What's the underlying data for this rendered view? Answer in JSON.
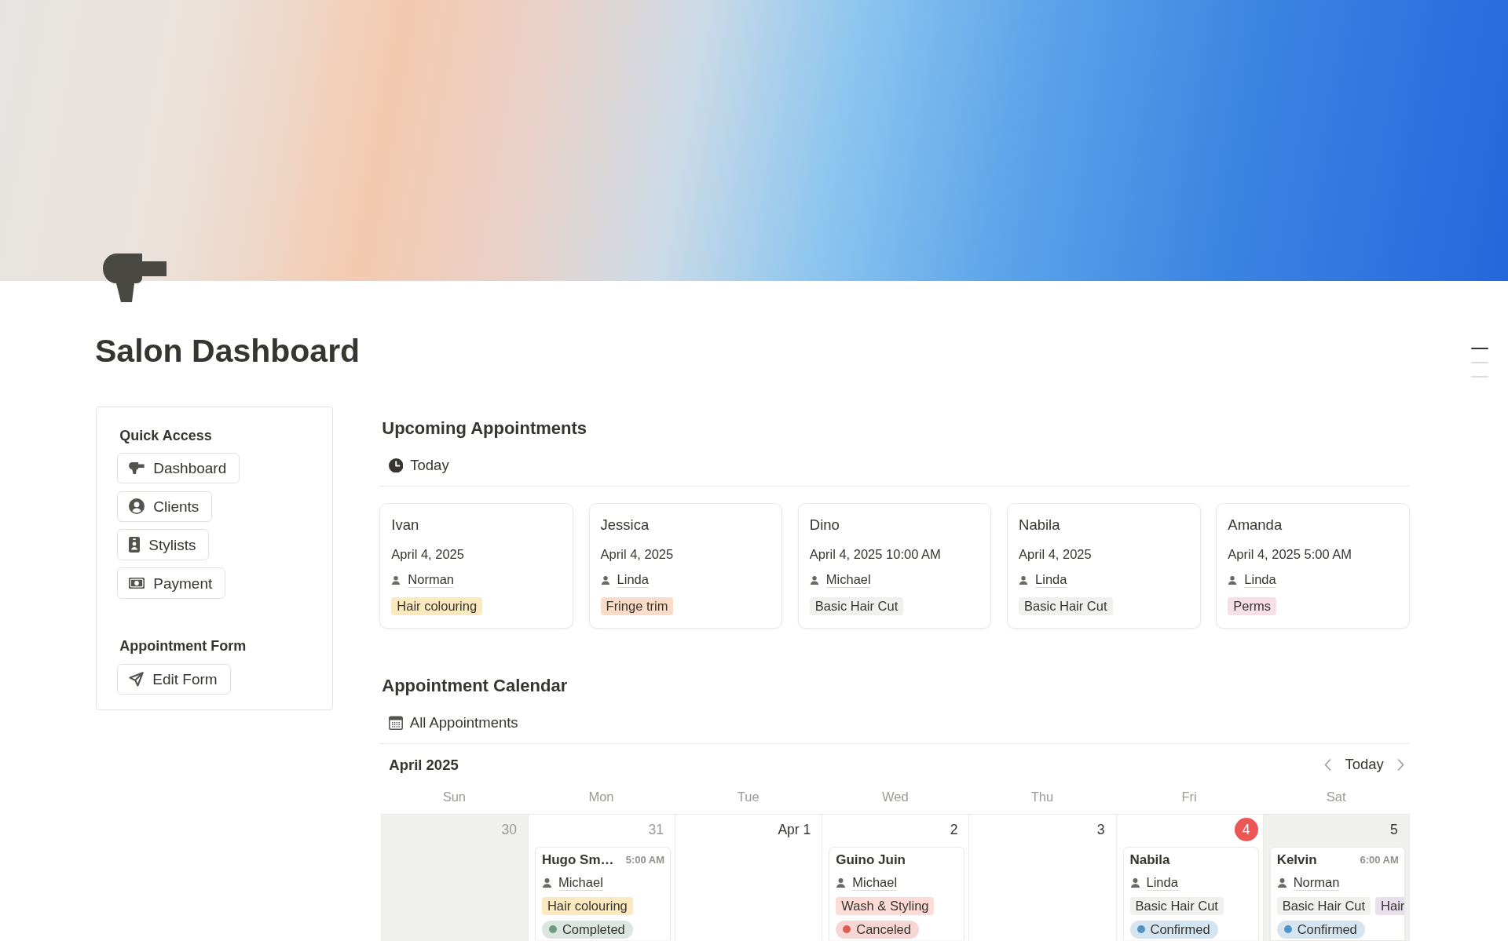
{
  "page": {
    "title": "Salon Dashboard"
  },
  "outline_markers": [
    {
      "selected": true
    },
    {
      "selected": false
    },
    {
      "selected": false
    }
  ],
  "sidebar": {
    "sections": [
      {
        "heading": "Quick Access",
        "links": [
          {
            "label": "Dashboard"
          },
          {
            "label": "Clients"
          },
          {
            "label": "Stylists"
          },
          {
            "label": "Payment"
          }
        ]
      },
      {
        "heading": "Appointment Form",
        "links": [
          {
            "label": "Edit Form"
          }
        ]
      }
    ]
  },
  "upcoming": {
    "heading": "Upcoming Appointments",
    "view_tab": "Today",
    "cards": [
      {
        "client": "Ivan",
        "date": "April 4, 2025",
        "stylist": "Norman",
        "services": [
          {
            "label": "Hair colouring",
            "color": "#fbe9bf"
          }
        ]
      },
      {
        "client": "Jessica",
        "date": "April 4, 2025",
        "stylist": "Linda",
        "services": [
          {
            "label": "Fringe trim",
            "color": "#fadcc8"
          }
        ]
      },
      {
        "client": "Dino",
        "date": "April 4, 2025 10:00 AM",
        "stylist": "Michael",
        "services": [
          {
            "label": "Basic Hair Cut",
            "color": "#f0f0ee"
          }
        ]
      },
      {
        "client": "Nabila",
        "date": "April 4, 2025",
        "stylist": "Linda",
        "services": [
          {
            "label": "Basic Hair Cut",
            "color": "#f0f0ee"
          }
        ]
      },
      {
        "client": "Amanda",
        "date": "April 4, 2025 5:00 AM",
        "stylist": "Linda",
        "services": [
          {
            "label": "Perms",
            "color": "#f6dfe9"
          }
        ]
      }
    ]
  },
  "calendar": {
    "heading": "Appointment Calendar",
    "view_tab": "All Appointments",
    "month": "April 2025",
    "today_button": "Today",
    "weekdays": [
      "Sun",
      "Mon",
      "Tue",
      "Wed",
      "Thu",
      "Fri",
      "Sat"
    ],
    "days": [
      {
        "label": "30",
        "in_month": false,
        "today": false,
        "weekend": true
      },
      {
        "label": "31",
        "in_month": false,
        "today": false,
        "weekend": false,
        "events": [
          {
            "client": "Hugo Sm…",
            "time": "5:00 AM",
            "stylist": "Michael",
            "services": [
              {
                "label": "Hair colouring",
                "color": "#fbe9bf"
              }
            ],
            "status": {
              "label": "Completed",
              "color": "#6c9b7d"
            }
          }
        ]
      },
      {
        "label": "Apr 1",
        "in_month": true,
        "today": false,
        "weekend": false
      },
      {
        "label": "2",
        "in_month": true,
        "today": false,
        "weekend": false,
        "events": [
          {
            "client": "Guino Juin",
            "stylist": "Michael",
            "services": [
              {
                "label": "Wash & Styling",
                "color": "#fddcd7"
              }
            ],
            "status": {
              "label": "Canceled",
              "color": "#df5a50"
            }
          }
        ]
      },
      {
        "label": "3",
        "in_month": true,
        "today": false,
        "weekend": false
      },
      {
        "label": "4",
        "in_month": true,
        "today": true,
        "weekend": false,
        "events": [
          {
            "client": "Nabila",
            "stylist": "Linda",
            "services": [
              {
                "label": "Basic Hair Cut",
                "color": "#f0f0ee"
              }
            ],
            "status": {
              "label": "Confirmed",
              "color": "#5193c4"
            }
          }
        ]
      },
      {
        "label": "5",
        "in_month": true,
        "today": false,
        "weekend": true,
        "events": [
          {
            "client": "Kelvin",
            "time": "6:00 AM",
            "stylist": "Norman",
            "services": [
              {
                "label": "Basic Hair Cut",
                "color": "#f0f0ee"
              },
              {
                "label": "Hair",
                "color": "#e8deee"
              }
            ],
            "status": {
              "label": "Confirmed",
              "color": "#5193c4"
            }
          }
        ]
      }
    ]
  }
}
